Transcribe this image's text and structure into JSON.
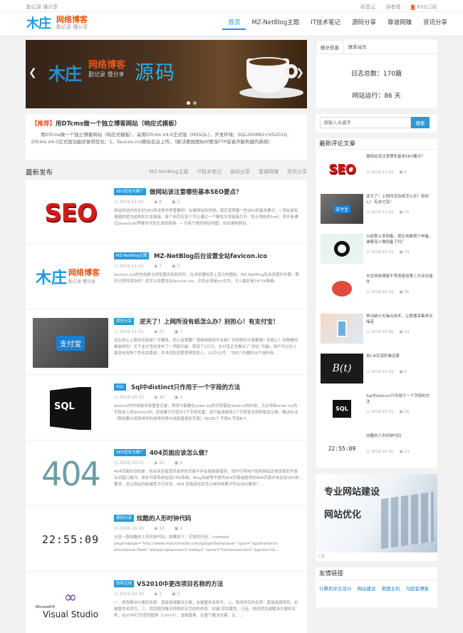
{
  "topbar": {
    "left": "勤记录 懂分享",
    "right": [
      "标签云",
      "读者墙",
      "RSS订阅"
    ]
  },
  "logo": {
    "mark": "木庄",
    "name": "网络博客",
    "sub": "勤记录 懂分享"
  },
  "nav": [
    "首页",
    "MZ-NetBlog主题",
    "IT技术笔记",
    "源码分享",
    "靠谱网赚",
    "资讯分享"
  ],
  "slider": {
    "mark": "木庄",
    "name": "网络博客",
    "sub": "勤记录 懂分享",
    "big": "源码",
    "prev": "❮",
    "next": "❯"
  },
  "notice": {
    "tag": "【推荐】",
    "title": "用DTcms做一个独立博客网站（响应式模板）",
    "text": "用DTcms做一个独立博客网站（响应式模板），采用DTcms V4.0正式版（MSSQL）。开发环境：SQL2008R2+VS2010。DTcms V4.0正式版功能修复和优化：1、favicon.ico图标后台上传。（解决要换图标时要连FTP或者开服务器的麻烦）"
  },
  "section": {
    "title": "最新发布",
    "cats": [
      "MZ-NetBlog主题",
      "IT技术笔记",
      "源码分享",
      "靠谱网赚",
      "资讯分享"
    ]
  },
  "posts": [
    {
      "cat": "SEO优化与推广",
      "title": "做网站该注意哪些基本SEO要点？",
      "date": "2016-11-02",
      "views": "8",
      "comments": "2",
      "excerpt": "网站的站内优化对SEO来说是非常重要的！在做网站的时候，就应该掌握一些SEO的基本要点：• 网站是有遵循的层次结构和文本链接。每个网页应至少可以通过一个静态文本链接打开。防止导航的href，而不是通过javascript等脚本代码生成的链接。• 为每个提供网站地图，向出搜网网站..."
    },
    {
      "cat": "MZ-NetBlog主题",
      "title": "MZ-NetBlog后台设置全站favicon.ico",
      "date": "2016-11-01",
      "views": "7",
      "comments": "0",
      "excerpt": "favicon.ico的作用是当浏览器浏览网页时，在浏览器标签上显示的图标：MZ-NetBlog后台设置的步骤：首先记得得保存好！就可以设置全站favicon.ico，文件必须是ico文件，大小最好是24*24像素。"
    },
    {
      "cat": "资讯分享",
      "title": "逆天了！上网所没有纸怎么办？别担心！有支付宝！",
      "date": "2016-11-01",
      "views": "25",
      "comments": "7",
      "excerpt": "还在担心上厕所没有纸？不要急，担心有需要！想被网络找不女嘛？突然想到大家都懂？别担心！你想看的都装修你！天下支付宝的发布了一项新功能：那就下1日天，支付宝正式推出了“到位”功能，用户可以在上面发布各种个性化的需求，并寻找附近愿意帮您的人。10月31号，“到位”开通的10个城市有..."
    },
    {
      "cat": "SQL",
      "title": "Sql中distinct只作用于一个字段的方法",
      "date": "2016-10-31",
      "views": "16",
      "comments": "4",
      "excerpt": "distinct的作用是去除重复记录，然而与需要在order by的字段需在distinct的时候，又必须用order by的字段加入到distinct中；而如果只对其中2个字段去重，就只能选择段2个字段查全部和相关记录。解决办法（假如要从按表排序的排序的表中选取重复的字段）SELECT 字段A,字段B F..."
    },
    {
      "cat": "SEO优化与推广",
      "title": "404页面应该怎么做？",
      "date": "2016-10-31",
      "views": "22",
      "comments": "4",
      "excerpt": "404页面的目的是：告诉浏览者其所请求的页面不存在或链接错误，同时引导用户使用网站其他页面而不是关闭窗口离开。很多开源系统包括CMS系统，Blog系统等不提供404页面或提供的404页面并未达到SEO的要求，这让网站的权威性大打折扣。404 页面该达到怎么样的效果才符合SEO要求？..."
    },
    {
      "cat": "源码分享",
      "title": "炫酷的人形时钟代码",
      "date": "2016-10-30",
      "views": "13",
      "comments": "2",
      "excerpt": "分享一款炫酷的人形时钟代码，效果如下：实现的代码：<embed pluginspage=\"http://www.macromedia.com/go/getflashplayer\" type=\"application/x-shockwave-flash\" allowscriptaccess=\"always\" name=\"honehoneclock\" bgcolor=&..."
    },
    {
      "cat": "软件应用",
      "title": "VS2010中更改项目名称的方法",
      "date": "2016-10-30",
      "views": "3",
      "comments": "0",
      "excerpt": "一、修改解决方案的名称：直接选择解决方案，右键重命名即可。二、修改项目的名称：直接选择项目，右键重命名即可。三、项目程序集名称和命名空间的修改：右键-项目属性，已经、修改项目或解决方案的名称；在VS中打开查找替换（Ctrl+F），选择替换，在整个解决方案。五、..."
    }
  ],
  "thumbs": {
    "seo": "SEO",
    "logo_mark": "木庄",
    "logo_name": "网络博客",
    "logo_sub": "勤记录 懂分享",
    "sql": "SQL",
    "n404": "404",
    "clock": "22:55:09",
    "vs_brand": "Microsoft®",
    "vs_name": "Visual Studio",
    "alipay": "支付宝"
  },
  "sidebar": {
    "tabs": [
      "统计信息",
      "联系站长"
    ],
    "stats": {
      "posts": "日志总数：170篇",
      "days": "网站运行：86 天"
    },
    "search": {
      "placeholder": "请输入关键字",
      "button": "搜索"
    },
    "comments_title": "最新评论文章",
    "comments": [
      {
        "text": "做网站该注意哪些基本SEO要点？",
        "date": "2016-11-02",
        "count": "6"
      },
      {
        "text": "逆天了！上网所没有纸怎么办？别担心！有支付宝！",
        "date": "2016-11-01",
        "count": "25"
      },
      {
        "text": "以前那么多网备，现在电脑很少申备，谁都没人做网备了吗？",
        "date": "2016-10-12",
        "count": "34"
      },
      {
        "text": "木庄网络博客不考虑使用第三方评论插件",
        "date": "2016-10-29",
        "count": "36"
      },
      {
        "text": "移动统计无噪点技术，让数据采集再无噪音",
        "date": "2016-10-06",
        "count": "14"
      },
      {
        "text": "用C#实现阶乘运算",
        "date": "2016-10-29",
        "count": "6"
      },
      {
        "text": "Sql中distinct只作用于一个字段的方法",
        "date": "2016-10-31",
        "count": "16"
      },
      {
        "text": "炫酷的人形时钟代码",
        "date": "2016-10-30",
        "count": "13"
      }
    ],
    "ad": {
      "line1": "专业网站建设",
      "line2": "网站优化",
      "tag": "广告"
    },
    "links_title": "友情链接",
    "links": [
      "计算机毕业设计",
      "网站建设",
      "美国主机",
      "马超金博客"
    ]
  },
  "colors": {
    "accent": "#1a9be0",
    "brand_orange": "#e9541b",
    "seo_red": "#d31b1b"
  }
}
